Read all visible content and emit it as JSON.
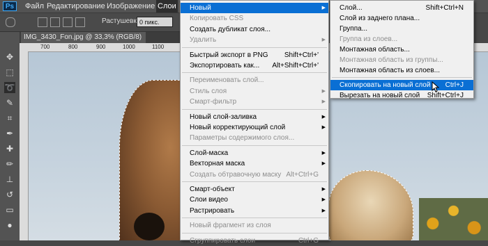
{
  "app": {
    "logo": "Ps"
  },
  "menubar": {
    "items": [
      "Файл",
      "Редактирование",
      "Изображение",
      "Слои"
    ],
    "active": "Слои"
  },
  "options": {
    "feather_label": "Растушевка:",
    "feather_value": "0 пикс."
  },
  "document": {
    "tab_title": "IMG_3430_Fon.jpg @ 33,3% (RGB/8)"
  },
  "ruler": {
    "ticks": [
      "700",
      "800",
      "900",
      "1000",
      "1100",
      "1200"
    ]
  },
  "layer_menu": {
    "groups": [
      [
        {
          "label": "Новый",
          "shortcut": "",
          "submenu": true,
          "disabled": false,
          "highlighted": true
        },
        {
          "label": "Копировать CSS",
          "shortcut": "",
          "submenu": false,
          "disabled": true,
          "highlighted": false
        },
        {
          "label": "Создать дубликат слоя...",
          "shortcut": "",
          "submenu": false,
          "disabled": false,
          "highlighted": false
        },
        {
          "label": "Удалить",
          "shortcut": "",
          "submenu": true,
          "disabled": true,
          "highlighted": false
        }
      ],
      [
        {
          "label": "Быстрый экспорт в PNG",
          "shortcut": "Shift+Ctrl+'",
          "submenu": false,
          "disabled": false,
          "highlighted": false
        },
        {
          "label": "Экспортировать как...",
          "shortcut": "Alt+Shift+Ctrl+'",
          "submenu": false,
          "disabled": false,
          "highlighted": false
        }
      ],
      [
        {
          "label": "Переименовать слой...",
          "shortcut": "",
          "submenu": false,
          "disabled": true,
          "highlighted": false
        },
        {
          "label": "Стиль слоя",
          "shortcut": "",
          "submenu": true,
          "disabled": true,
          "highlighted": false
        },
        {
          "label": "Смарт-фильтр",
          "shortcut": "",
          "submenu": true,
          "disabled": true,
          "highlighted": false
        }
      ],
      [
        {
          "label": "Новый слой-заливка",
          "shortcut": "",
          "submenu": true,
          "disabled": false,
          "highlighted": false
        },
        {
          "label": "Новый корректирующий слой",
          "shortcut": "",
          "submenu": true,
          "disabled": false,
          "highlighted": false
        },
        {
          "label": "Параметры содержимого слоя...",
          "shortcut": "",
          "submenu": false,
          "disabled": true,
          "highlighted": false
        }
      ],
      [
        {
          "label": "Слой-маска",
          "shortcut": "",
          "submenu": true,
          "disabled": false,
          "highlighted": false
        },
        {
          "label": "Векторная маска",
          "shortcut": "",
          "submenu": true,
          "disabled": false,
          "highlighted": false
        },
        {
          "label": "Создать обтравочную маску",
          "shortcut": "Alt+Ctrl+G",
          "submenu": false,
          "disabled": true,
          "highlighted": false
        }
      ],
      [
        {
          "label": "Смарт-объект",
          "shortcut": "",
          "submenu": true,
          "disabled": false,
          "highlighted": false
        },
        {
          "label": "Слои видео",
          "shortcut": "",
          "submenu": true,
          "disabled": false,
          "highlighted": false
        },
        {
          "label": "Растрировать",
          "shortcut": "",
          "submenu": true,
          "disabled": false,
          "highlighted": false
        }
      ],
      [
        {
          "label": "Новый фрагмент из слоя",
          "shortcut": "",
          "submenu": false,
          "disabled": true,
          "highlighted": false
        }
      ],
      [
        {
          "label": "Сгруппировать слои",
          "shortcut": "Ctrl+G",
          "submenu": false,
          "disabled": true,
          "highlighted": false
        }
      ]
    ]
  },
  "new_submenu": {
    "groups": [
      [
        {
          "label": "Слой...",
          "shortcut": "Shift+Ctrl+N",
          "disabled": false,
          "highlighted": false
        },
        {
          "label": "Слой из заднего плана...",
          "shortcut": "",
          "disabled": false,
          "highlighted": false
        },
        {
          "label": "Группа...",
          "shortcut": "",
          "disabled": false,
          "highlighted": false
        },
        {
          "label": "Группа из слоев...",
          "shortcut": "",
          "disabled": true,
          "highlighted": false
        },
        {
          "label": "Монтажная область...",
          "shortcut": "",
          "disabled": false,
          "highlighted": false
        },
        {
          "label": "Монтажная область из группы...",
          "shortcut": "",
          "disabled": true,
          "highlighted": false
        },
        {
          "label": "Монтажная область из слоев...",
          "shortcut": "",
          "disabled": false,
          "highlighted": false
        }
      ],
      [
        {
          "label": "Скопировать на новый слой",
          "shortcut": "Ctrl+J",
          "disabled": false,
          "highlighted": true
        },
        {
          "label": "Вырезать на новый слой",
          "shortcut": "Shift+Ctrl+J",
          "disabled": false,
          "highlighted": false
        }
      ]
    ]
  },
  "colors": {
    "highlight": "#0a6fd4",
    "menu_bg": "#f0f0f0",
    "ui_dark": "#535353"
  }
}
